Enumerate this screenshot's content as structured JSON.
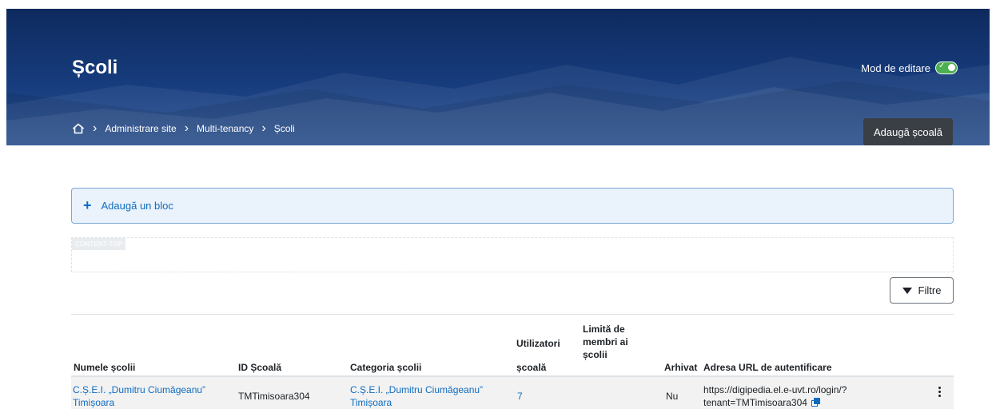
{
  "header": {
    "title": "Școli",
    "edit_mode_label": "Mod de editare",
    "edit_mode_on": true,
    "breadcrumb": [
      "Administrare site",
      "Multi-tenancy",
      "Școli"
    ],
    "add_school_label": "Adaugă școală"
  },
  "blocks": {
    "add_block_label": "Adaugă un bloc",
    "region_tag": "CONTENT-TOP"
  },
  "filters_label": "Filtre",
  "table": {
    "headers": {
      "name": "Numele școlii",
      "id": "ID Școală",
      "category": "Categoria școlii",
      "users_line1": "Utilizatori",
      "users_line2": "școală",
      "limit_line1": "Limită de",
      "limit_line2": "membri ai",
      "limit_line3": "școlii",
      "archived": "Arhivat",
      "url": "Adresa URL de autentificare"
    },
    "rows": [
      {
        "name_line1": "C.Ș.E.I. „Dumitru Ciumăgeanu”",
        "name_line2": "Timișoara",
        "id": "TMTimisoara304",
        "category_line1": "C.Ș.E.I. „Dumitru Ciumăgeanu”",
        "category_line2": "Timișoara",
        "users": "7",
        "limit": "",
        "archived": "Nu",
        "url_line1": "https://digipedia.el.e-uvt.ro/login/?",
        "url_line2": "tenant=TMTimisoara304"
      }
    ]
  },
  "colors": {
    "header_dark": "#0e2a5e",
    "link": "#0f6cbf",
    "toggle_on": "#4caf50"
  },
  "icons": [
    "home-icon",
    "chevron-right-icon",
    "toggle-check-icon",
    "plus-icon",
    "filter-funnel-icon",
    "copy-icon",
    "kebab-menu-icon"
  ]
}
